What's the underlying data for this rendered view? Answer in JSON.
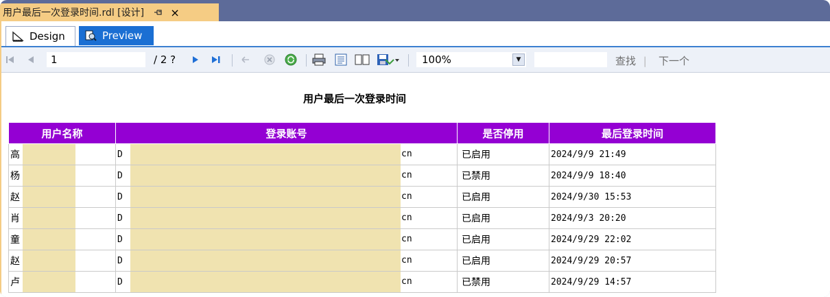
{
  "document_tab": {
    "title": "用户最后一次登录时间.rdl [设计]",
    "close_glyph": "×"
  },
  "view_tabs": [
    {
      "label": "Design",
      "icon": "ruler-triangle-icon"
    },
    {
      "label": "Preview",
      "icon": "preview-icon"
    }
  ],
  "toolbar": {
    "page_current": "1",
    "page_total": "/ 2 ?",
    "zoom": "100%",
    "find_label": "查找",
    "find_separator": "|",
    "next_label": "下一个"
  },
  "report": {
    "title": "用户最后一次登录时间",
    "columns": [
      "用户名称",
      "登录账号",
      "是否停用",
      "最后登录时间"
    ],
    "rows": [
      {
        "name": "高",
        "account_prefix": "D",
        "account_suffix": "cn",
        "status": "已启用",
        "last_login": "2024/9/9 21:49"
      },
      {
        "name": "杨",
        "account_prefix": "D",
        "account_suffix": "cn",
        "status": "已禁用",
        "last_login": "2024/9/9 18:40"
      },
      {
        "name": "赵",
        "account_prefix": "D",
        "account_suffix": "cn",
        "status": "已启用",
        "last_login": "2024/9/30 15:53"
      },
      {
        "name": "肖",
        "account_prefix": "D",
        "account_suffix": "cn",
        "status": "已启用",
        "last_login": "2024/9/3 20:20"
      },
      {
        "name": "童",
        "account_prefix": "D",
        "account_suffix": "cn",
        "status": "已启用",
        "last_login": "2024/9/29 22:02"
      },
      {
        "name": "赵",
        "account_prefix": "D",
        "account_suffix": "cn",
        "status": "已启用",
        "last_login": "2024/9/29 20:57"
      },
      {
        "name": "卢",
        "account_prefix": "D",
        "account_suffix": "cn",
        "status": "已禁用",
        "last_login": "2024/9/29 14:57"
      }
    ]
  },
  "colors": {
    "header_bg": "#9400d3",
    "redaction": "#f0e3b0",
    "active_tab": "#1b6fd3",
    "doc_tab": "#f5cc84"
  }
}
